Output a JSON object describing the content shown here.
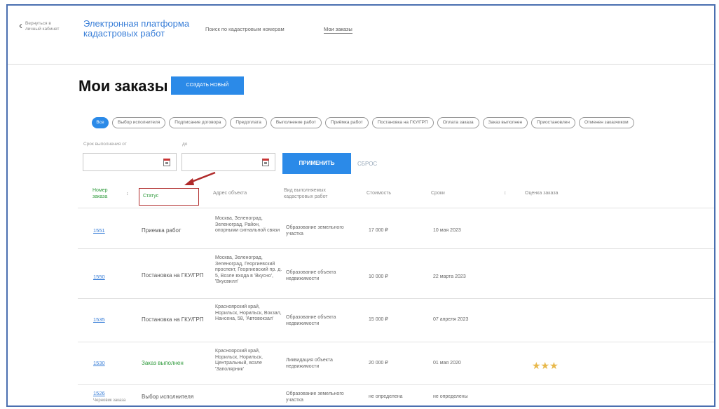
{
  "header": {
    "back_label": "Вернуться в личный кабинет",
    "brand": "Электронная платформа кадастровых работ",
    "nav": [
      "Поиск по кадастровым номерам",
      "Мои заказы"
    ]
  },
  "page": {
    "title": "Мои заказы",
    "create_label": "создать новый"
  },
  "filters": {
    "chips": [
      "Все",
      "Выбор исполнителя",
      "Подписание договора",
      "Предоплата",
      "Выполнение работ",
      "Приёмка работ",
      "Постановка на ГКУ/ГРП",
      "Оплата заказа",
      "Заказ выполнен",
      "Приостановлен",
      "Отменен заказчиком"
    ],
    "date_label": "Срок выполнения от",
    "date_to_label": "до",
    "apply_label": "применить",
    "reset_label": "сброс"
  },
  "table": {
    "headers": [
      "Номер заказа",
      "Статус",
      "Адрес объекта",
      "Вид выполняемых кадастровых работ",
      "Стоимость",
      "Сроки",
      "Оценка заказа"
    ],
    "rows": [
      {
        "id": "1551",
        "status": "Приемка работ",
        "address": "Москва, Зеленоград, Зеленоград, Район, опорными сигнальной связи",
        "work": "Образование земельного участка",
        "cost": "17 000 ₽",
        "date": "10 мая 2023",
        "sub": ""
      },
      {
        "id": "1550",
        "status": "Постановка на ГКУ/ГРП",
        "address": "Москва, Зеленоград, Зеленоград, Георгиевский проспект, Георгиевский пр. д. 5, Возле входа в 'Вкусно', 'Вкусвилл'",
        "work": "Образование объекта недвижимости",
        "cost": "10 000 ₽",
        "date": "22 марта 2023",
        "sub": ""
      },
      {
        "id": "1535",
        "status": "Постановка на ГКУ/ГРП",
        "address": "Красноярский край, Норильск, Норильск, Вокзал, Нансена, 58, 'Автовокзал'",
        "work": "Образование объекта недвижимости",
        "cost": "15 000 ₽",
        "date": "07 апреля 2023",
        "sub": ""
      },
      {
        "id": "1530",
        "status": "Заказ выполнен",
        "address": "Красноярский край, Норильск, Норильск, Центральный, возле 'Заполярник'",
        "work": "Ликвидация объекта недвижимости",
        "cost": "20 000 ₽",
        "date": "01 мая 2020",
        "sub": "",
        "rating": "★★★"
      },
      {
        "id": "1526",
        "status": "Выбор исполнителя",
        "address": "",
        "work": "Образование земельного участка",
        "cost": "не определена",
        "date": "не определены",
        "sub": "Черновик заказа"
      }
    ]
  },
  "colors": {
    "accent": "#2b8ae8",
    "green": "#2e9a3b",
    "highlight": "#b02a2a"
  }
}
